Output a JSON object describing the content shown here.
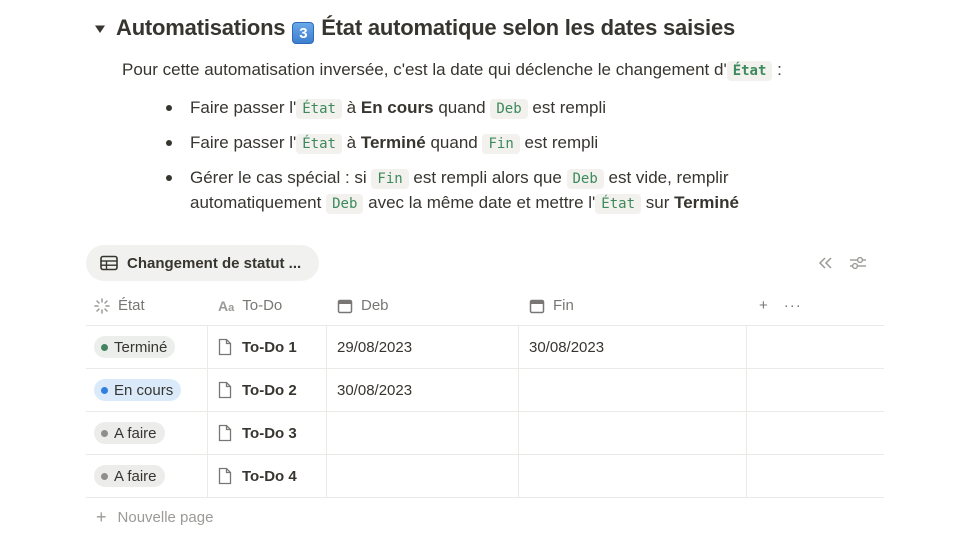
{
  "heading": {
    "prefix": "Automatisations",
    "keycap": "3",
    "suffix": "État automatique selon les dates saisies"
  },
  "intro": {
    "text": "Pour cette automatisation inversée, c'est la date qui déclenche le changement d'",
    "code": "État",
    "tail": ":"
  },
  "bullets": [
    {
      "p1": "Faire passer l'",
      "c1": "État",
      "p2": " à ",
      "b1": "En cours",
      "p3": " quand ",
      "c2": "Deb",
      "p4": " est rempli"
    },
    {
      "p1": "Faire passer l'",
      "c1": "État",
      "p2": " à ",
      "b1": "Terminé",
      "p3": " quand ",
      "c2": "Fin",
      "p4": " est rempli"
    },
    {
      "p1": "Gérer le cas spécial : si ",
      "c1": "Fin",
      "p2": " est rempli alors que ",
      "c2": "Deb",
      "p3": " est vide, remplir automatiquement ",
      "c3": "Deb",
      "p4": " avec la même date et mettre l'",
      "c4": "État",
      "p5": " sur ",
      "b1": "Terminé"
    }
  ],
  "view": {
    "tab_label": "Changement de statut ..."
  },
  "table": {
    "columns": [
      "État",
      "To-Do",
      "Deb",
      "Fin"
    ],
    "rows": [
      {
        "status": "Terminé",
        "title": "To-Do 1",
        "deb": "29/08/2023",
        "fin": "30/08/2023"
      },
      {
        "status": "En cours",
        "title": "To-Do 2",
        "deb": "30/08/2023",
        "fin": ""
      },
      {
        "status": "A faire",
        "title": "To-Do 3",
        "deb": "",
        "fin": ""
      },
      {
        "status": "A faire",
        "title": "To-Do 4",
        "deb": "",
        "fin": ""
      }
    ]
  },
  "status_colors": {
    "Terminé": {
      "bg": "#eceeec",
      "dot": "#448361"
    },
    "En cours": {
      "bg": "#dbeafa",
      "dot": "#2f7fe0"
    },
    "A faire": {
      "bg": "#ececeb",
      "dot": "#8f8e8b"
    }
  },
  "footer": {
    "new_page_label": "Nouvelle page"
  },
  "icons": {
    "toggle": "triangle-down-icon",
    "table_view": "table-icon",
    "collapse": "double-chevron-left-icon",
    "settings": "sliders-icon",
    "status": "status-spinner-icon",
    "title": "text-aa-icon",
    "date": "calendar-icon",
    "page": "document-icon",
    "add": "plus-icon",
    "more": "ellipsis-icon"
  }
}
